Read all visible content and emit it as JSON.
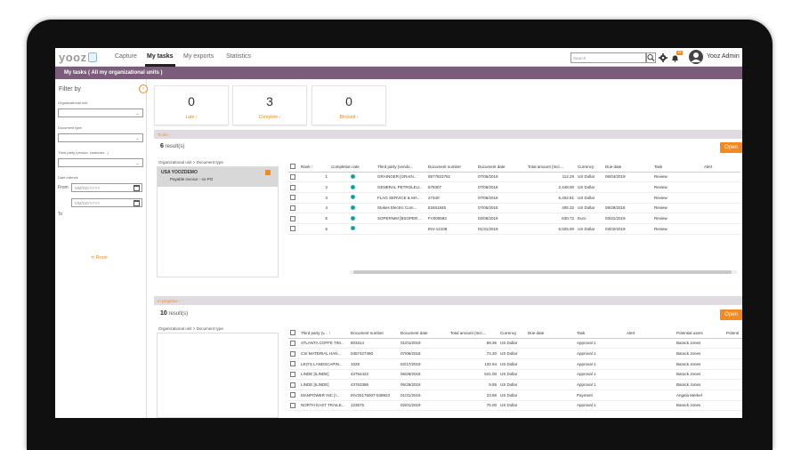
{
  "app": {
    "logo_text": "yooz",
    "brand_color": "#f28a20",
    "header_color": "#7b5c7b"
  },
  "nav": {
    "tabs": [
      {
        "label": "Capture"
      },
      {
        "label": "My tasks"
      },
      {
        "label": "My exports"
      },
      {
        "label": "Statistics"
      }
    ],
    "active_tab": "My tasks",
    "search_placeholder": "Search",
    "notification_count": "99",
    "user_name": "Yooz Admin"
  },
  "breadcrumb": "My tasks ( All my organizational units )",
  "sidebar": {
    "title": "Filter by",
    "org_unit_label": "Organizational unit",
    "doc_type_label": "Document type",
    "third_party_label": "Third party (vendor, customer...)",
    "date_interval_label": "Date interval",
    "from_label": "From",
    "to_label": "To",
    "date_placeholder": "MM/DD/YYYY",
    "reset_label": "Reset"
  },
  "stats": [
    {
      "value": "0",
      "label": "Late"
    },
    {
      "value": "3",
      "label": "Complete"
    },
    {
      "value": "0",
      "label": "Blocked"
    }
  ],
  "todo": {
    "section_label": "To do",
    "results_count": "6",
    "results_suffix": " result(s)",
    "open_label": "Open",
    "org_header": "Organizational unit > Document type",
    "org_unit": "USA YOOZDEMO",
    "doc_type": "Payable invoice - no PO",
    "columns": [
      "Rank",
      "Completion rate",
      "Third party (vendo...",
      "Document number",
      "Document date",
      "Total amount (Incl....",
      "Currency",
      "Due date",
      "Task",
      "Alert"
    ],
    "rows": [
      {
        "rank": "1",
        "third": "GRAINGER [GRAIN...",
        "num": "9577823751",
        "date": "07/05/2019",
        "amount": "112.29",
        "cur": "US Dollar",
        "due": "06/04/2019",
        "task": "Review"
      },
      {
        "rank": "2",
        "third": "GENERAL PETROLEU...",
        "num": "578307",
        "date": "07/05/2018",
        "amount": "2,448.00",
        "cur": "US Dollar",
        "due": "",
        "task": "Review"
      },
      {
        "rank": "3",
        "third": "FLAG SERVICE & MA...",
        "num": "27340",
        "date": "07/05/2018",
        "amount": "6,402.81",
        "cur": "US Dollar",
        "due": "",
        "task": "Review"
      },
      {
        "rank": "4",
        "third": "Stokes Electric Com...",
        "num": "53461845",
        "date": "07/05/2018",
        "amount": "406.32",
        "cur": "US Dollar",
        "due": "08/29/2018",
        "task": "Review"
      },
      {
        "rank": "5",
        "third": "SOPERNIM [BSOPER...",
        "num": "FV000593",
        "date": "02/08/2019",
        "amount": "630.72",
        "cur": "Euro",
        "due": "03/31/2019",
        "task": "Review"
      },
      {
        "rank": "6",
        "third": "",
        "num": "INV-12108",
        "date": "01/31/2019",
        "amount": "6,025.00",
        "cur": "US Dollar",
        "due": "03/02/2019",
        "task": "Review"
      }
    ]
  },
  "inprogress": {
    "section_label": "In progress",
    "results_count": "10",
    "results_suffix": " result(s)",
    "open_label": "Open",
    "org_header": "Organizational unit > Document type",
    "columns": [
      "Third party (v...",
      "Document number",
      "Document date",
      "Total amount (Incl....",
      "Currency",
      "Due date",
      "Task",
      "Alert",
      "Potential users",
      "Potenti"
    ],
    "rows": [
      {
        "third": "ATLANTA COFFE TIM...",
        "num": "803314",
        "date": "01/01/2019",
        "amount": "69.36",
        "cur": "US Dollar",
        "due": "",
        "task": "Approval 1",
        "users": "Barack Jones"
      },
      {
        "third": "CSI MATERIAL HAN...",
        "num": "0457427490",
        "date": "07/06/2018",
        "amount": "74.20",
        "cur": "US Dollar",
        "due": "",
        "task": "Approval 1",
        "users": "Barack Jones"
      },
      {
        "third": "LEO'S LANDSCAPIN...",
        "num": "1029",
        "date": "02/17/2019",
        "amount": "132.94",
        "cur": "US Dollar",
        "due": "",
        "task": "Approval 1",
        "users": "Barack Jones"
      },
      {
        "third": "LINDE [ILINDE]",
        "num": "43764422",
        "date": "06/28/2018",
        "amount": "541.00",
        "cur": "US Dollar",
        "due": "",
        "task": "Approval 1",
        "users": "Barack Jones"
      },
      {
        "third": "LINDE [ILINDE]",
        "num": "43763386",
        "date": "06/28/2018",
        "amount": "9.85",
        "cur": "US Dollar",
        "due": "",
        "task": "Approval 1",
        "users": "Barack Jones"
      },
      {
        "third": "MANPOWER INC [I...",
        "num": "INV25176007-539923",
        "date": "01/31/2019",
        "amount": "23.58",
        "cur": "US Dollar",
        "due": "",
        "task": "Payment",
        "users": "Angela Merkel"
      },
      {
        "third": "NORTH EAST TRAILE...",
        "num": "123575",
        "date": "02/01/2019",
        "amount": "75.00",
        "cur": "US Dollar",
        "due": "",
        "task": "Approval 1",
        "users": "Barack Jones"
      }
    ]
  }
}
